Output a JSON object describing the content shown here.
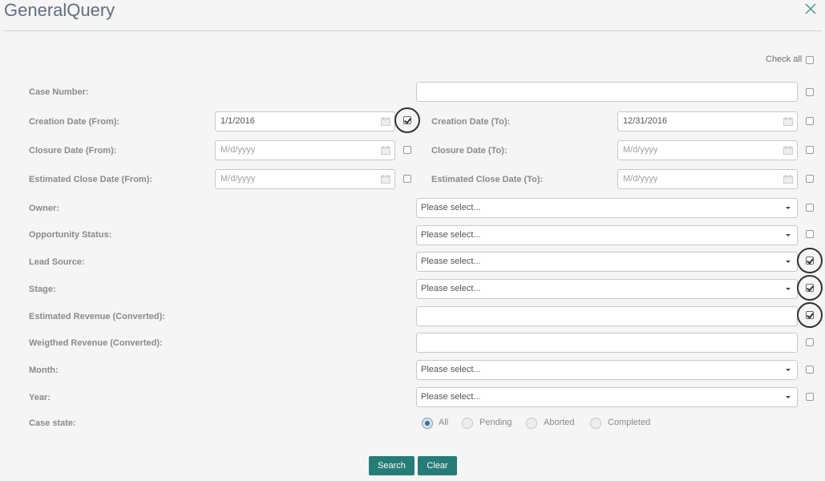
{
  "header": {
    "title": "GeneralQuery",
    "close_icon": "close-icon"
  },
  "check_all_label": "Check all",
  "labels": {
    "case_number": "Case Number:",
    "creation_from": "Creation Date (From):",
    "creation_to": "Creation Date (To):",
    "closure_from": "Closure Date (From):",
    "closure_to": "Closure Date (To):",
    "est_close_from": "Estimated Close Date (From):",
    "est_close_to": "Estimated Close Date (To):",
    "owner": "Owner:",
    "opportunity_status": "Opportunity Status:",
    "lead_source": "Lead Source:",
    "stage": "Stage:",
    "est_revenue": "Estimated Revenue (Converted):",
    "weighted_revenue": "Weigthed Revenue (Converted):",
    "month": "Month:",
    "year": "Year:",
    "case_state": "Case state:"
  },
  "values": {
    "case_number": "",
    "creation_from": "1/1/2016",
    "creation_to": "12/31/2016",
    "est_revenue": "",
    "weighted_revenue": ""
  },
  "date_placeholder": "M/d/yyyy",
  "select_placeholder": "Please select...",
  "case_state_options": [
    "All",
    "Pending",
    "Aborted",
    "Completed"
  ],
  "case_state_selected": "All",
  "checked": [
    "creation_from",
    "lead_source",
    "stage",
    "est_revenue"
  ],
  "buttons": {
    "search": "Search",
    "clear": "Clear"
  },
  "colors": {
    "accent": "#267c77",
    "title": "#5f6f7d",
    "close": "#4a9a8c"
  }
}
